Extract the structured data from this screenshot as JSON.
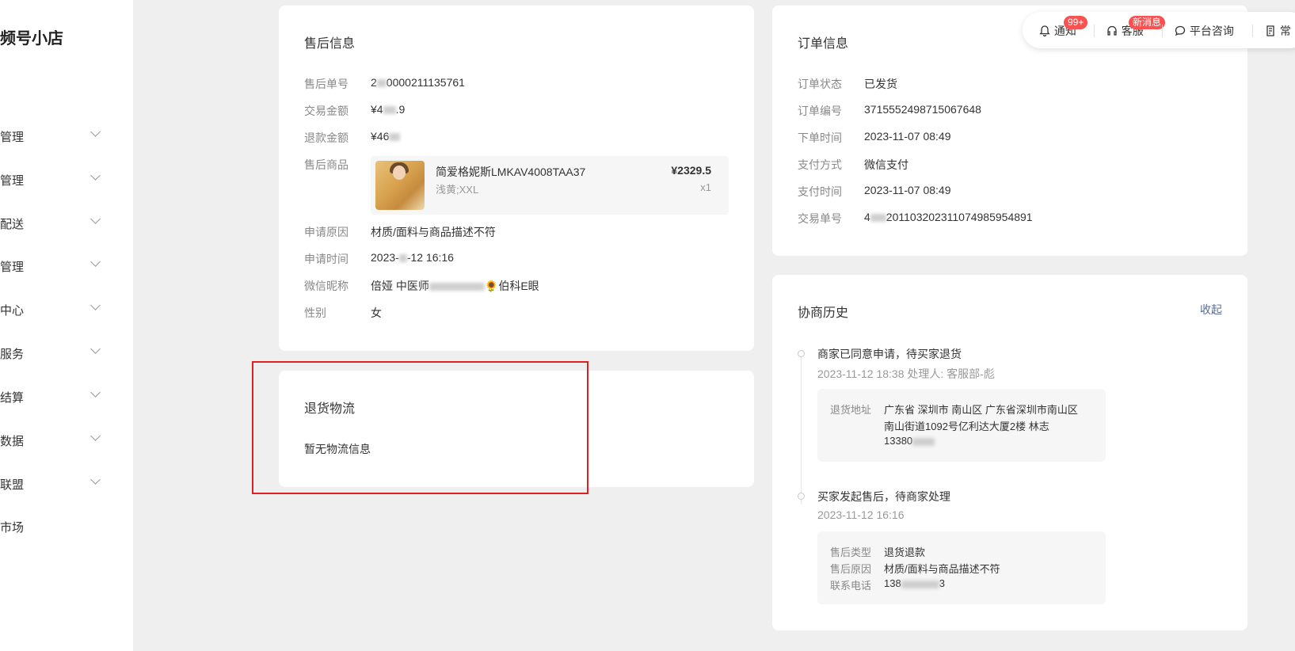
{
  "sidebar": {
    "brand": "频号小店",
    "items": [
      {
        "label": "管理"
      },
      {
        "label": "管理"
      },
      {
        "label": "配送"
      },
      {
        "label": "管理"
      },
      {
        "label": "中心"
      },
      {
        "label": "服务"
      },
      {
        "label": "结算"
      },
      {
        "label": "数据"
      },
      {
        "label": "联盟"
      },
      {
        "label": "市场"
      }
    ]
  },
  "topbar": {
    "notify": "通知",
    "notify_badge": "99+",
    "service": "客服",
    "service_badge": "新消息",
    "consult": "平台咨询",
    "common": "常"
  },
  "aftersale": {
    "title": "售后信息",
    "no_label": "售后单号",
    "no_prefix": "2",
    "no_suffix": "0000211135761",
    "trade_amount_label": "交易金额",
    "trade_amount_prefix": "¥4",
    "trade_amount_suffix": ".9",
    "refund_label": "退款金额",
    "refund_prefix": "¥46",
    "product_label": "售后商品",
    "product": {
      "name": "简爱格妮斯LMKAV4008TAA37",
      "spec": "浅黄;XXL",
      "price": "¥2329.5",
      "qty": "x1"
    },
    "reason_label": "申请原因",
    "reason": "材质/面料与商品描述不符",
    "time_label": "申请时间",
    "time_prefix": "2023-",
    "time_suffix": "-12 16:16",
    "nick_label": "微信昵称",
    "nick_prefix": "倍娅 中医师",
    "nick_suffix": "🌻伯科E眼",
    "gender_label": "性别",
    "gender": "女"
  },
  "logistics": {
    "title": "退货物流",
    "empty": "暂无物流信息"
  },
  "order": {
    "title": "订单信息",
    "status_label": "订单状态",
    "status": "已发货",
    "no_label": "订单编号",
    "no": "3715552498715067648",
    "created_label": "下单时间",
    "created": "2023-11-07 08:49",
    "pay_method_label": "支付方式",
    "pay_method": "微信支付",
    "pay_time_label": "支付时间",
    "pay_time": "2023-11-07 08:49",
    "trade_no_label": "交易单号",
    "trade_no_prefix": "4",
    "trade_no_suffix": "20110320231107498595489​1"
  },
  "history": {
    "title": "协商历史",
    "collapse": "收起",
    "events": [
      {
        "title": "商家已同意申请，待买家退货",
        "meta": "2023-11-12 18:38 处理人: 客服部-彪",
        "address_label": "退货地址",
        "address_line1": "广东省 深圳市 南山区 广东省深圳市南山区",
        "address_line2": "南山街道1092号亿利达大厦2楼 林志",
        "address_line3": "13380"
      },
      {
        "title": "买家发起售后，待商家处理",
        "meta": "2023-11-12 16:16",
        "type_label": "售后类型",
        "type": "退货退款",
        "reason_label": "售后原因",
        "reason": "材质/面料与商品描述不符",
        "phone_label": "联系电话",
        "phone_prefix": "138",
        "phone_suffix": "3"
      }
    ]
  }
}
